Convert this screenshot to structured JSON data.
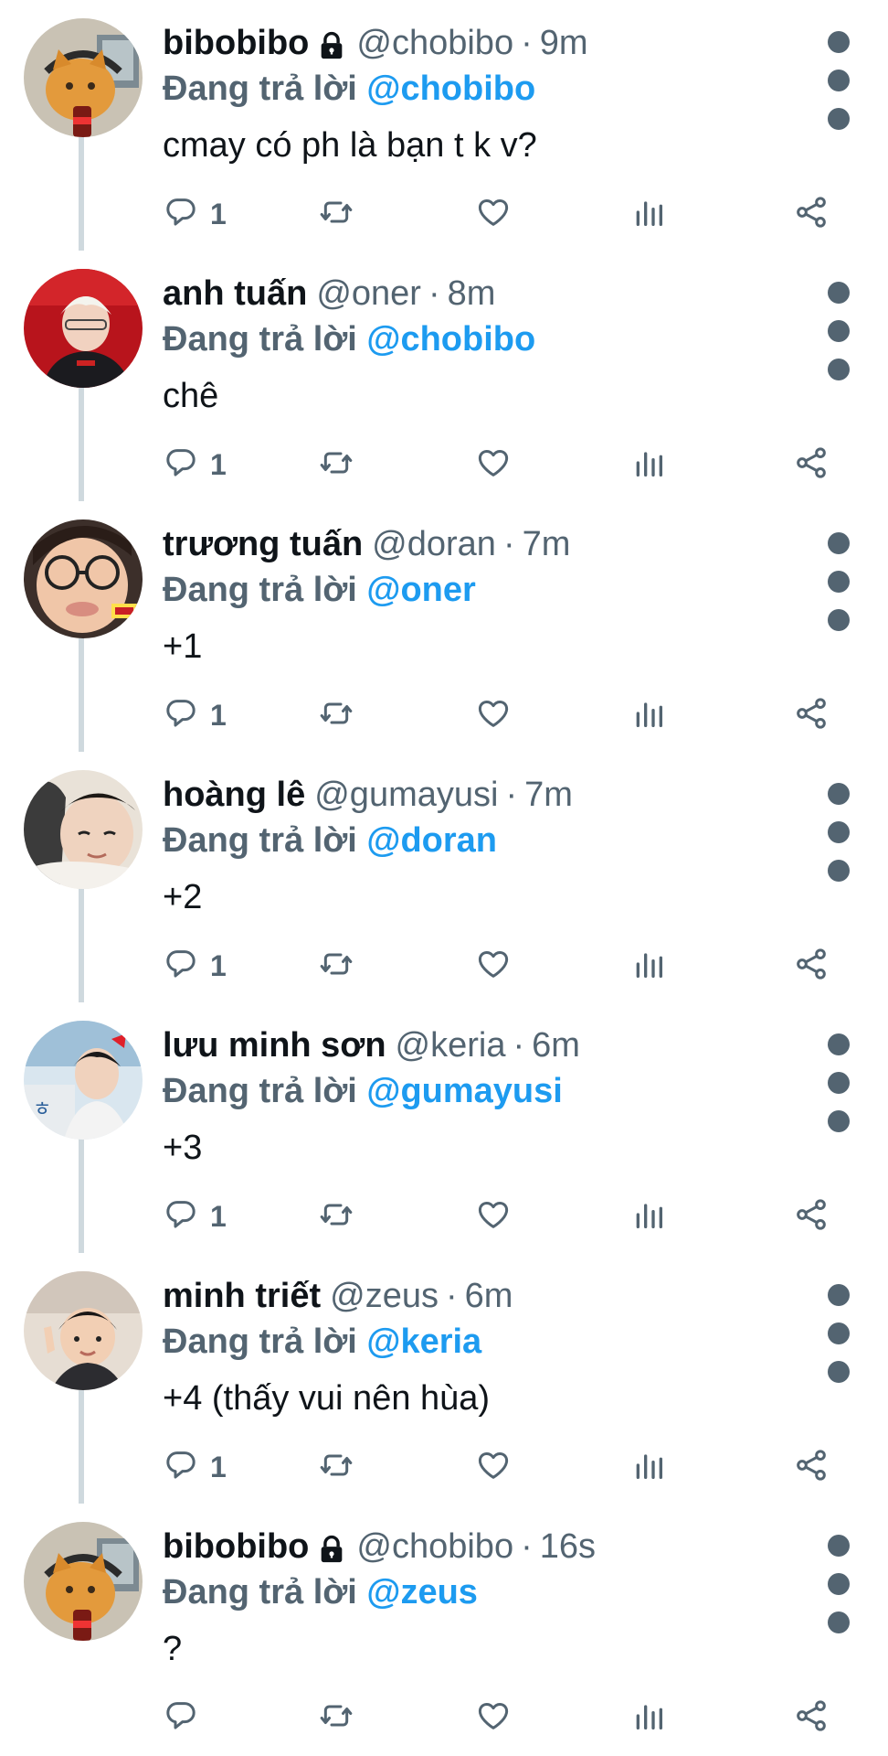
{
  "tweets": [
    {
      "name": "bibobibo",
      "locked": true,
      "handle": "@chobibo",
      "time": "9m",
      "reply_prefix": "Đang trả lời",
      "reply_to": "@chobibo",
      "text": "cmay có ph là bạn t k v?",
      "reply_count": "1",
      "avatar": "orange-cat"
    },
    {
      "name": "anh tuấn",
      "locked": false,
      "handle": "@oner",
      "time": "8m",
      "reply_prefix": "Đang trả lời",
      "reply_to": "@chobibo",
      "text": "chê",
      "reply_count": "1",
      "avatar": "red-photo"
    },
    {
      "name": "trương tuấn",
      "locked": false,
      "handle": "@doran",
      "time": "7m",
      "reply_prefix": "Đang trả lời",
      "reply_to": "@oner",
      "text": "+1",
      "reply_count": "1",
      "avatar": "glasses-photo"
    },
    {
      "name": "hoàng lê",
      "locked": false,
      "handle": "@gumayusi",
      "time": "7m",
      "reply_prefix": "Đang trả lời",
      "reply_to": "@doran",
      "text": "+2",
      "reply_count": "1",
      "avatar": "pillow-photo"
    },
    {
      "name": "lưu minh sơn",
      "locked": false,
      "handle": "@keria",
      "time": "6m",
      "reply_prefix": "Đang trả lời",
      "reply_to": "@gumayusi",
      "text": "+3",
      "reply_count": "1",
      "avatar": "outdoor-photo"
    },
    {
      "name": "minh triết",
      "locked": false,
      "handle": "@zeus",
      "time": "6m",
      "reply_prefix": "Đang trả lời",
      "reply_to": "@keria",
      "text": "+4 (thấy vui nên hùa)",
      "reply_count": "1",
      "avatar": "child-photo"
    },
    {
      "name": "bibobibo",
      "locked": true,
      "handle": "@chobibo",
      "time": "16s",
      "reply_prefix": "Đang trả lời",
      "reply_to": "@zeus",
      "text": "?",
      "reply_count": "",
      "avatar": "orange-cat"
    }
  ],
  "colors": {
    "text_primary": "#0f1419",
    "text_secondary": "#536471",
    "accent": "#1d9bf0",
    "thread_line": "#cfd9de",
    "background": "#ffffff"
  },
  "icons": {
    "reply": "reply-icon",
    "retweet": "retweet-icon",
    "like": "heart-icon",
    "stats": "stats-icon",
    "share": "share-icon",
    "more": "more-vertical-icon",
    "lock": "lock-icon"
  }
}
